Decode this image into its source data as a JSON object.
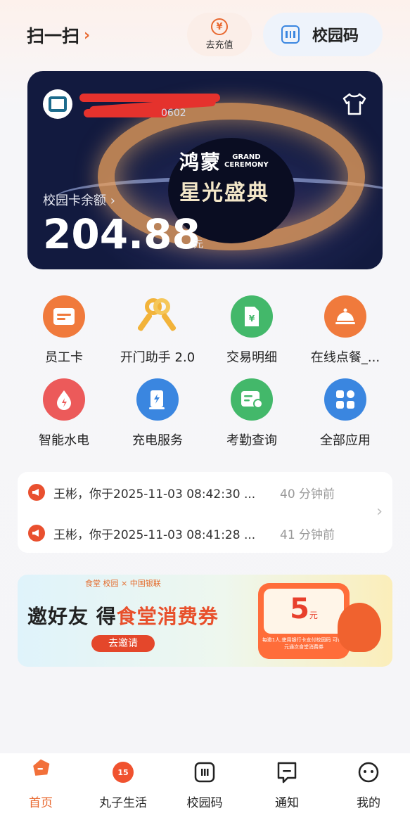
{
  "header": {
    "scan_label": "扫一扫",
    "scan_chevron": "›",
    "recharge_label": "去充值",
    "recharge_icon": "yen-circle-icon",
    "campus_code_label": "校园码"
  },
  "card": {
    "card_number_partial": "0602",
    "event_title_cn1": "鸿蒙",
    "event_title_en1": "GRAND",
    "event_title_en2": "CEREMONY",
    "event_title_cn2": "星光盛典",
    "balance_label": "校园卡余额 ›",
    "balance": "204.88",
    "unit": "元"
  },
  "apps": [
    {
      "label": "员工卡",
      "color": "#f07a3c",
      "icon": "card-icon"
    },
    {
      "label": "开门助手 2.0",
      "color": "#f2b33a",
      "icon": "keys-icon"
    },
    {
      "label": "交易明细",
      "color": "#43b86a",
      "icon": "receipt-icon"
    },
    {
      "label": "在线点餐_...",
      "color": "#f07a3c",
      "icon": "dish-icon"
    },
    {
      "label": "智能水电",
      "color": "#ec5a5a",
      "icon": "water-electric-icon"
    },
    {
      "label": "充电服务",
      "color": "#3a86e0",
      "icon": "charging-icon"
    },
    {
      "label": "考勤查询",
      "color": "#43b86a",
      "icon": "attendance-icon"
    },
    {
      "label": "全部应用",
      "color": "#3a86e0",
      "icon": "grid-apps-icon"
    }
  ],
  "notices": [
    {
      "text": "王彬，你于2025-11-03 08:42:30 ...",
      "time": "40 分钟前"
    },
    {
      "text": "王彬，你于2025-11-03 08:41:28 ...",
      "time": "41 分钟前"
    }
  ],
  "banner": {
    "brand": "食堂 校园 × 中国银联",
    "headline_prefix": "邀好友 得",
    "headline_highlight": "食堂消费券",
    "cta": "去邀请",
    "coupon_amount": "5",
    "coupon_unit": "元",
    "coupon_desc": "每邀1人,使用银行卡支付校园码 可得5元通次食堂消费券"
  },
  "tabs": [
    {
      "label": "首页",
      "icon": "home-icon",
      "active": true
    },
    {
      "label": "丸子生活",
      "icon": "life-icon",
      "active": false
    },
    {
      "label": "校园码",
      "icon": "campus-code-icon",
      "active": false
    },
    {
      "label": "通知",
      "icon": "message-icon",
      "active": false
    },
    {
      "label": "我的",
      "icon": "profile-icon",
      "active": false
    }
  ],
  "colors": {
    "accent": "#e8682f",
    "blue": "#3a86e0",
    "redaction": "#e5322d"
  }
}
